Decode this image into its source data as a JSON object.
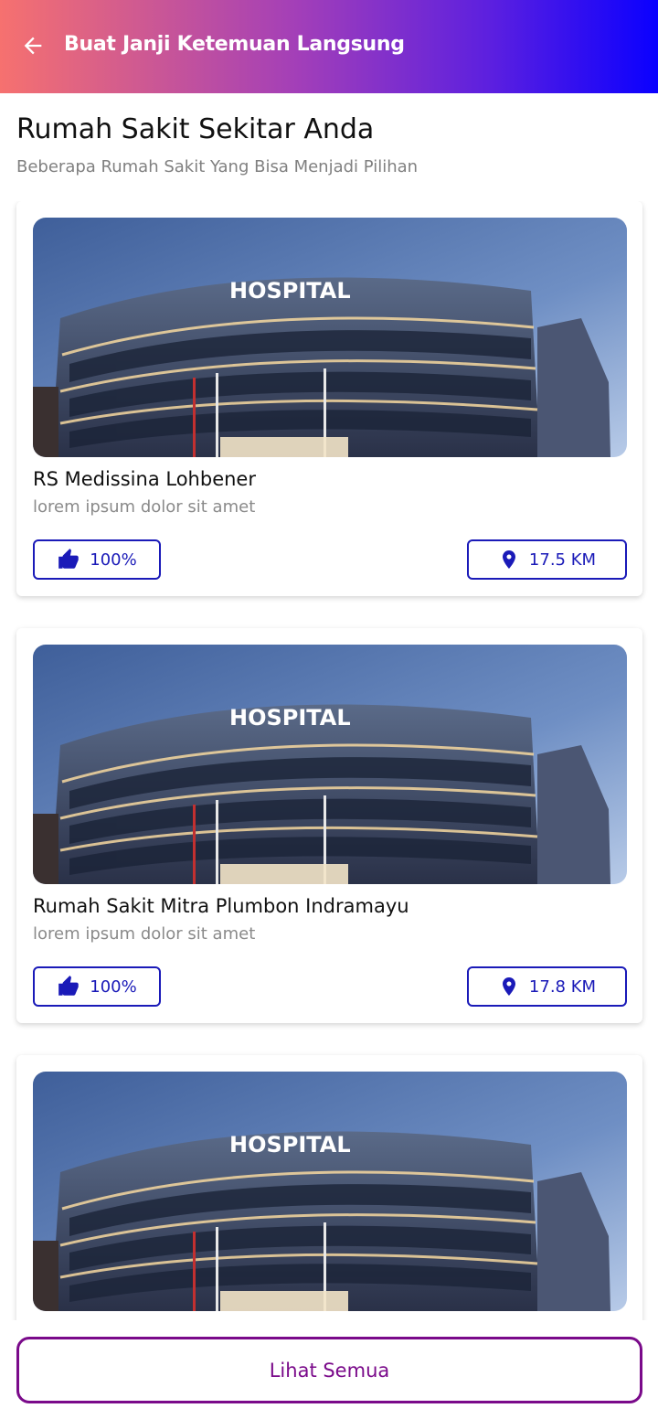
{
  "header": {
    "title": "Buat Janji Ketemuan Langsung",
    "back_icon": "arrow-left-icon"
  },
  "section": {
    "title": "Rumah Sakit Sekitar Anda",
    "subtitle": "Beberapa Rumah Sakit Yang Bisa Menjadi Pilihan"
  },
  "hospitals": [
    {
      "name": "RS Medissina Lohbener",
      "description": "lorem ipsum dolor sit amet",
      "rating": "100%",
      "distance": "17.5 KM",
      "sign": "HOSPITAL"
    },
    {
      "name": "Rumah Sakit Mitra Plumbon Indramayu",
      "description": "lorem ipsum dolor sit amet",
      "rating": "100%",
      "distance": "17.8 KM",
      "sign": "HOSPITAL"
    },
    {
      "name": "",
      "description": "",
      "rating": "",
      "distance": "",
      "sign": "HOSPITAL"
    }
  ],
  "footer": {
    "view_all_label": "Lihat Semua"
  },
  "colors": {
    "accent": "#1a1ab8",
    "button": "#7a0a8a",
    "gradient_start": "#f6716f",
    "gradient_end": "#0a00ff"
  }
}
